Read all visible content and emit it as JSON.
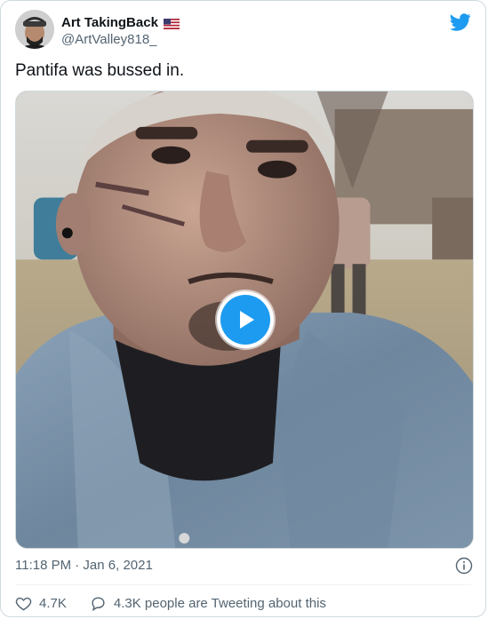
{
  "author": {
    "display_name": "Art TakingBack",
    "handle": "@ArtValley818_",
    "flag": "us-flag-icon"
  },
  "tweet": {
    "text": "Pantifa was bussed in.",
    "timestamp": "11:18 PM · Jan 6, 2021"
  },
  "media": {
    "type": "video",
    "play_icon": "play-icon"
  },
  "actions": {
    "likes": "4.7K",
    "replies_text": "4.3K people are Tweeting about this"
  },
  "colors": {
    "twitter_blue": "#1d9bf0",
    "secondary_text": "#536471",
    "border": "#cfd9de"
  }
}
